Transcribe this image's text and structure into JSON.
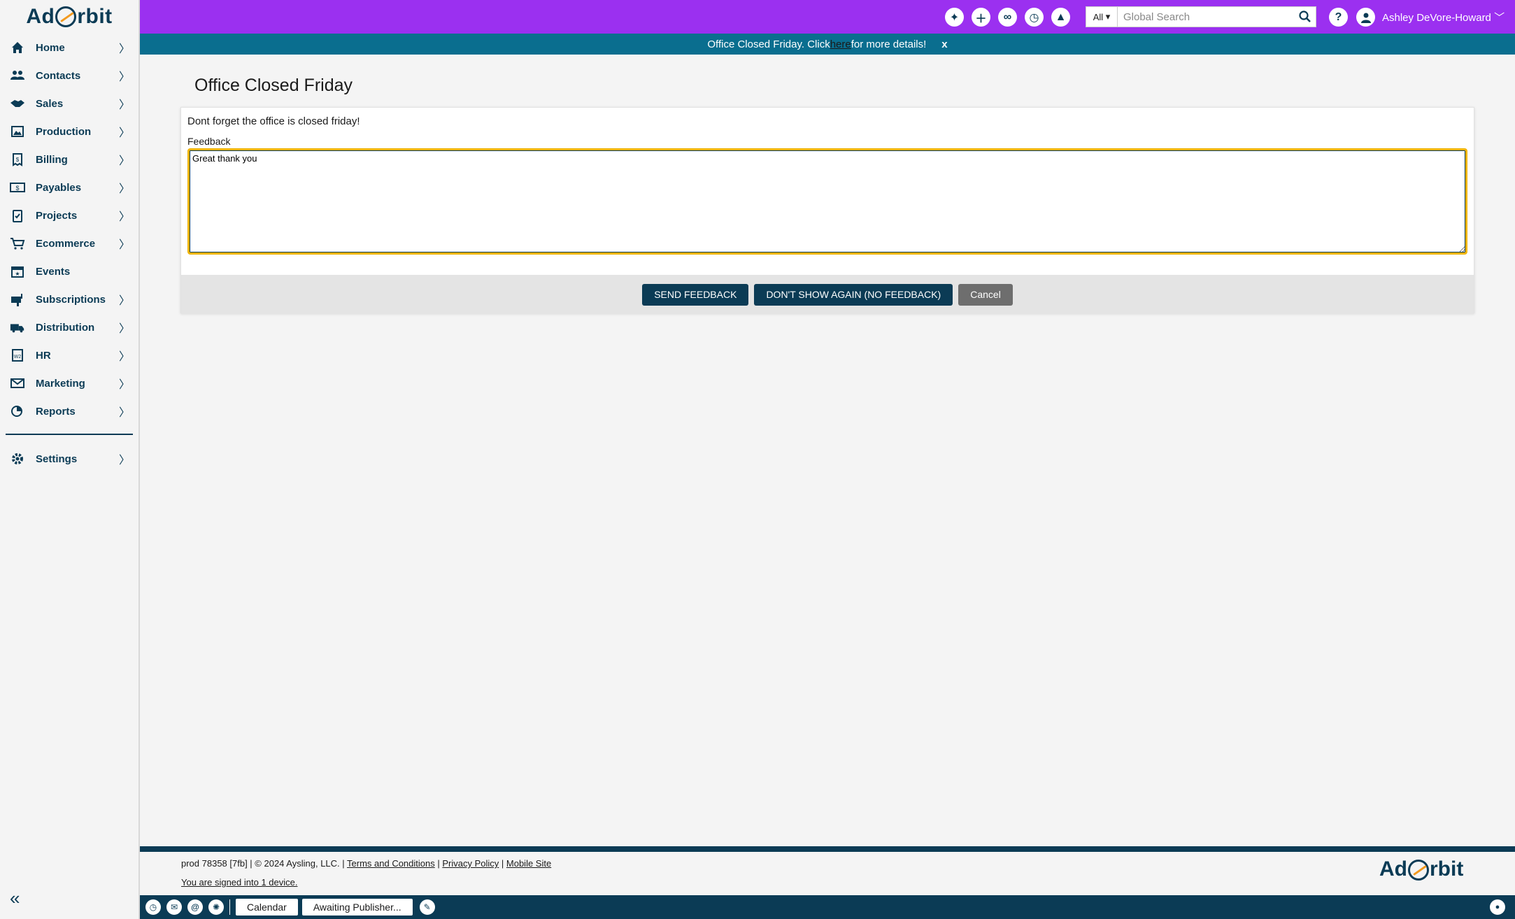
{
  "app": {
    "logo_left": "Ad",
    "logo_right": "rbit"
  },
  "sidebar": {
    "items": [
      {
        "label": "Home",
        "icon": "home-icon",
        "chevron": true
      },
      {
        "label": "Contacts",
        "icon": "contacts-icon",
        "chevron": true
      },
      {
        "label": "Sales",
        "icon": "handshake-icon",
        "chevron": true
      },
      {
        "label": "Production",
        "icon": "production-icon",
        "chevron": true
      },
      {
        "label": "Billing",
        "icon": "billing-icon",
        "chevron": true
      },
      {
        "label": "Payables",
        "icon": "payables-icon",
        "chevron": true
      },
      {
        "label": "Projects",
        "icon": "clipboard-icon",
        "chevron": true
      },
      {
        "label": "Ecommerce",
        "icon": "cart-icon",
        "chevron": true
      },
      {
        "label": "Events",
        "icon": "calendar-star-icon",
        "chevron": false
      },
      {
        "label": "Subscriptions",
        "icon": "mailbox-icon",
        "chevron": true
      },
      {
        "label": "Distribution",
        "icon": "truck-icon",
        "chevron": true
      },
      {
        "label": "HR",
        "icon": "w2-form-icon",
        "chevron": true
      },
      {
        "label": "Marketing",
        "icon": "envelope-icon",
        "chevron": true
      },
      {
        "label": "Reports",
        "icon": "reports-icon",
        "chevron": true
      }
    ],
    "settings": {
      "label": "Settings",
      "icon": "gear-icon"
    },
    "chevron_glyph": "〉",
    "collapse_glyph": "«"
  },
  "header": {
    "search_scope": "All",
    "search_placeholder": "Global Search",
    "help_glyph": "?",
    "user_name": "Ashley DeVore-Howard",
    "user_chevron": "﹀"
  },
  "banner": {
    "text_before": "Office Closed Friday. Click ",
    "link_text": "here",
    "text_after": " for more details!",
    "close": "x"
  },
  "main": {
    "title": "Office Closed Friday",
    "message": "Dont forget the office is closed friday!",
    "feedback_label": "Feedback",
    "feedback_value": "Great thank you",
    "buttons": {
      "send": "SEND FEEDBACK",
      "dont_show": "DON'T SHOW AGAIN (NO FEEDBACK)",
      "cancel": "Cancel"
    }
  },
  "footer": {
    "build": "prod 78358 [7fb] | © 2024 Aysling, LLC. | ",
    "terms": "Terms and Conditions",
    "sep": " | ",
    "privacy": "Privacy Policy",
    "mobile": "Mobile Site",
    "signed_in": "You are signed into 1 device."
  },
  "taskbar": {
    "calendar": "Calendar",
    "awaiting": "Awaiting Publisher..."
  },
  "colors": {
    "header_purple": "#9b30f0",
    "banner_teal": "#0a6e8f",
    "navy": "#0b3b55",
    "focus_yellow": "#f0b400"
  }
}
